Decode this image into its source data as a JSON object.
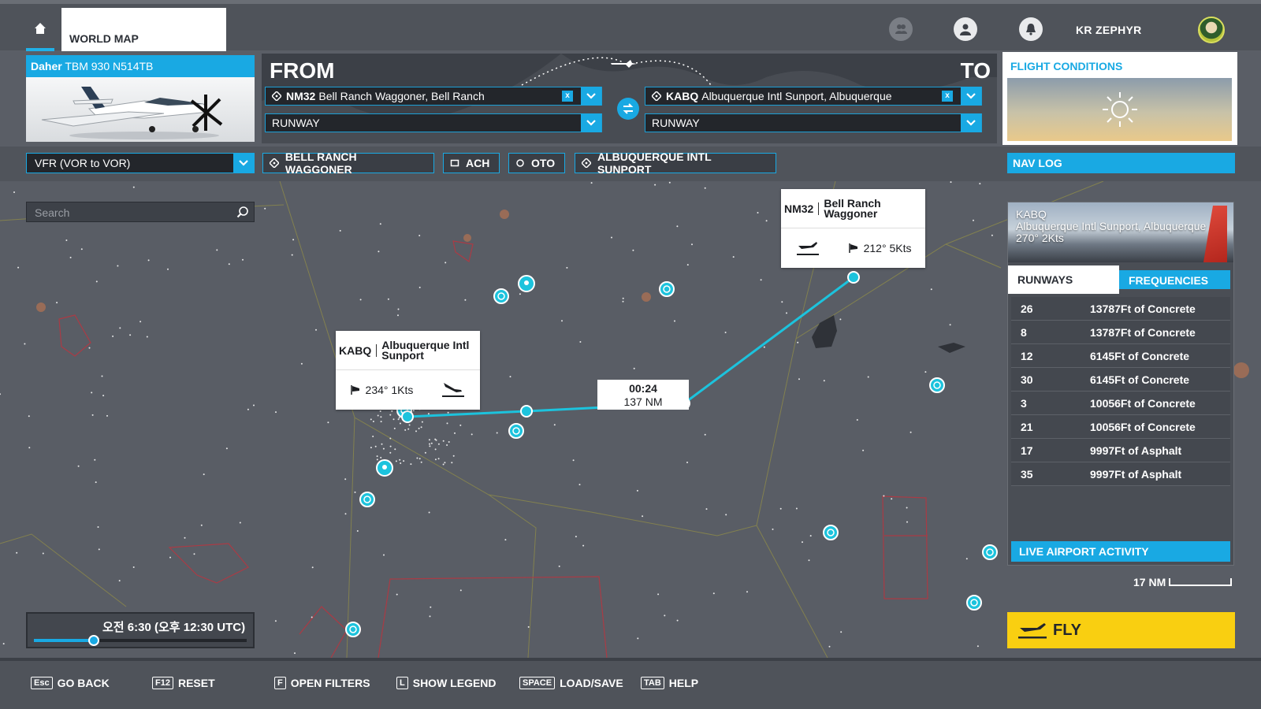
{
  "topbar": {
    "tab_label": "WORLD MAP",
    "username": "KR ZEPHYR"
  },
  "aircraft": {
    "maker": "Daher",
    "model": "TBM 930 N514TB"
  },
  "route": {
    "from_label": "FROM",
    "to_label": "TO",
    "departure": {
      "icao": "NM32",
      "name": "Bell Ranch Waggoner, Bell Ranch",
      "spot": "RUNWAY"
    },
    "arrival": {
      "icao": "KABQ",
      "name": "Albuquerque Intl Sunport, Albuquerque",
      "spot": "RUNWAY"
    },
    "clear_symbol": "x"
  },
  "conditions": {
    "title": "FLIGHT CONDITIONS"
  },
  "flightplan": {
    "type": "VFR (VOR to VOR)",
    "waypoints": [
      "BELL RANCH WAGGONER",
      "ACH",
      "OTO",
      "ALBUQUERQUE INTL SUNPORT"
    ]
  },
  "navlog_label": "NAV LOG",
  "search": {
    "placeholder": "Search"
  },
  "callouts": {
    "departure": {
      "icao": "NM32",
      "name": "Bell Ranch Waggoner",
      "wind": "212° 5Kts"
    },
    "arrival": {
      "icao": "KABQ",
      "name": "Albuquerque Intl Sunport",
      "wind": "234° 1Kts"
    }
  },
  "leg": {
    "time": "00:24",
    "distance": "137 NM"
  },
  "airport_card": {
    "icao": "KABQ",
    "name": "Albuquerque Intl Sunport, Albuquerque",
    "wind": "270° 2Kts",
    "tab_runways": "RUNWAYS",
    "tab_frequencies": "FREQUENCIES",
    "runways": [
      {
        "num": "26",
        "desc": "13787Ft of Concrete"
      },
      {
        "num": "8",
        "desc": "13787Ft of Concrete"
      },
      {
        "num": "12",
        "desc": "6145Ft of Concrete"
      },
      {
        "num": "30",
        "desc": "6145Ft of Concrete"
      },
      {
        "num": "3",
        "desc": "10056Ft of Concrete"
      },
      {
        "num": "21",
        "desc": "10056Ft of Concrete"
      },
      {
        "num": "17",
        "desc": "9997Ft of Asphalt"
      },
      {
        "num": "35",
        "desc": "9997Ft of Asphalt"
      }
    ],
    "live_label": "LIVE AIRPORT ACTIVITY"
  },
  "scale_label": "17 NM",
  "fly_label": "FLY",
  "time": {
    "local": "오전 6:30",
    "utc": "(오후 12:30 UTC)",
    "progress": 0.28
  },
  "hotkeys": [
    {
      "key": "Esc",
      "label": "GO BACK"
    },
    {
      "key": "F12",
      "label": "RESET"
    },
    {
      "key": "F",
      "label": "OPEN FILTERS"
    },
    {
      "key": "L",
      "label": "SHOW LEGEND"
    },
    {
      "key": "SPACE",
      "label": "LOAD/SAVE"
    },
    {
      "key": "TAB",
      "label": "HELP"
    }
  ],
  "colors": {
    "accent": "#19a9e3",
    "route_line": "#1cc3dd",
    "fly": "#f9cf11",
    "airspace": "#b8353f"
  }
}
